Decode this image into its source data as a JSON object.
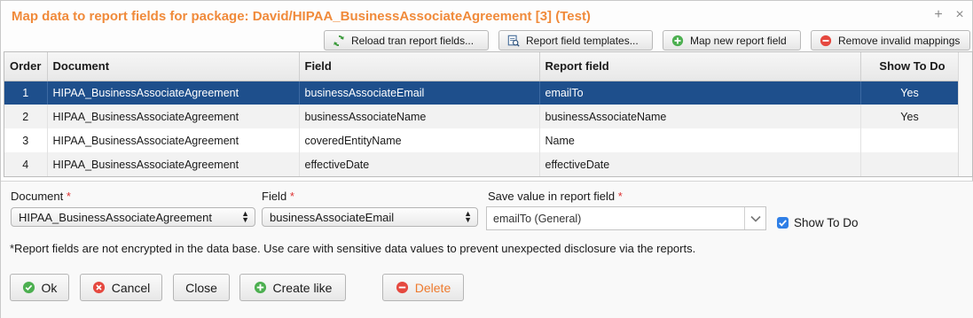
{
  "dialog": {
    "title": "Map data to report fields for package: David/HIPAA_BusinessAssociateAgreement [3] (Test)",
    "plus_glyph": "+",
    "close_glyph": "×"
  },
  "toolbar": {
    "reload_label": "Reload tran report fields...",
    "templates_label": "Report field templates...",
    "map_new_label": "Map new report field",
    "remove_invalid_label": "Remove invalid mappings"
  },
  "grid": {
    "columns": [
      "Order",
      "Document",
      "Field",
      "Report field",
      "Show To Do"
    ],
    "rows": [
      {
        "order": "1",
        "document": "HIPAA_BusinessAssociateAgreement",
        "field": "businessAssociateEmail",
        "report_field": "emailTo",
        "show_todo": "Yes"
      },
      {
        "order": "2",
        "document": "HIPAA_BusinessAssociateAgreement",
        "field": "businessAssociateName",
        "report_field": "businessAssociateName",
        "show_todo": "Yes"
      },
      {
        "order": "3",
        "document": "HIPAA_BusinessAssociateAgreement",
        "field": "coveredEntityName",
        "report_field": "Name",
        "show_todo": ""
      },
      {
        "order": "4",
        "document": "HIPAA_BusinessAssociateAgreement",
        "field": "effectiveDate",
        "report_field": "effectiveDate",
        "show_todo": ""
      }
    ],
    "selected_row_index": 0
  },
  "form": {
    "document_label": "Document",
    "document_value": "HIPAA_BusinessAssociateAgreement",
    "field_label": "Field",
    "field_value": "businessAssociateEmail",
    "save_value_label": "Save value in report field",
    "save_value_value": "emailTo (General)",
    "required_mark": "*",
    "show_todo_label": "Show To Do",
    "show_todo_checked": true,
    "note": "*Report fields are not encrypted in the data base. Use care with sensitive data values to prevent unexpected disclosure via the reports."
  },
  "buttons": {
    "ok": "Ok",
    "cancel": "Cancel",
    "close": "Close",
    "create_like": "Create like",
    "delete": "Delete"
  },
  "colors": {
    "title": "#f08a3a",
    "selected_row": "#1e4f8c",
    "green_icon": "#4caf50",
    "red_icon": "#e5483f",
    "checkbox": "#2f7fe6",
    "required": "#dd3333"
  }
}
